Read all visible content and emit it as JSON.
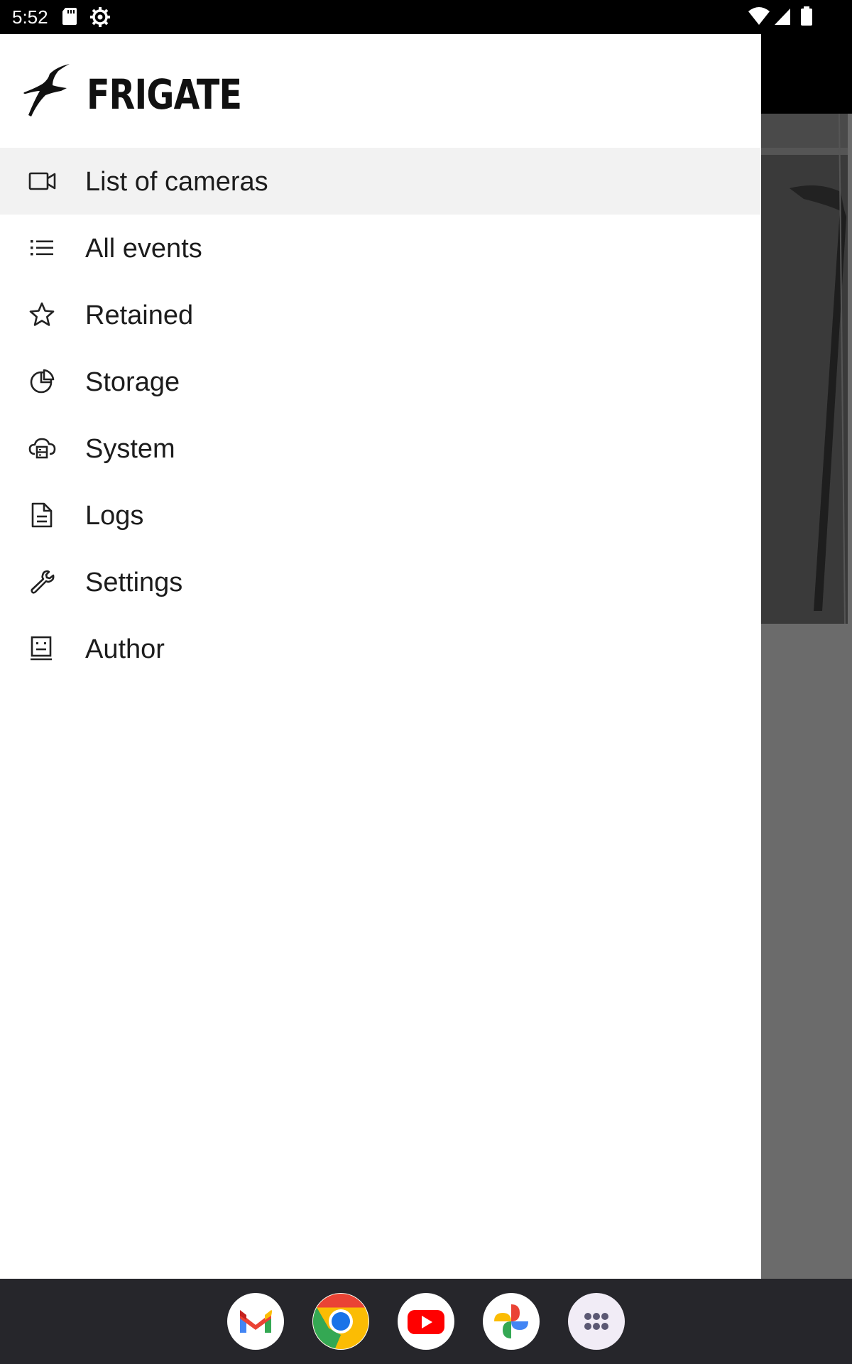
{
  "status_bar": {
    "time": "5:52",
    "left_icons": [
      "sd-card-icon",
      "settings-gear-icon"
    ],
    "right_icons": [
      "wifi-icon",
      "cell-signal-icon",
      "battery-icon"
    ]
  },
  "drawer": {
    "app_name": "FRIGATE",
    "logo_icon": "frigate-bird-icon",
    "items": [
      {
        "label": "List of cameras",
        "icon": "videocam-icon",
        "active": true
      },
      {
        "label": "All events",
        "icon": "list-icon",
        "active": false
      },
      {
        "label": "Retained",
        "icon": "star-icon",
        "active": false
      },
      {
        "label": "Storage",
        "icon": "pie-chart-icon",
        "active": false
      },
      {
        "label": "System",
        "icon": "cloud-server-icon",
        "active": false
      },
      {
        "label": "Logs",
        "icon": "document-icon",
        "active": false
      },
      {
        "label": "Settings",
        "icon": "wrench-icon",
        "active": false
      },
      {
        "label": "Author",
        "icon": "contact-card-icon",
        "active": false
      }
    ]
  },
  "dock": {
    "apps": [
      "Gmail",
      "Chrome",
      "YouTube",
      "Photos",
      "App drawer"
    ]
  },
  "colors": {
    "status_bar": "#000000",
    "drawer_bg": "#ffffff",
    "active_item_bg": "#f2f2f2",
    "scrim": "#6b6b6b",
    "dock_bg": "#26262b"
  }
}
